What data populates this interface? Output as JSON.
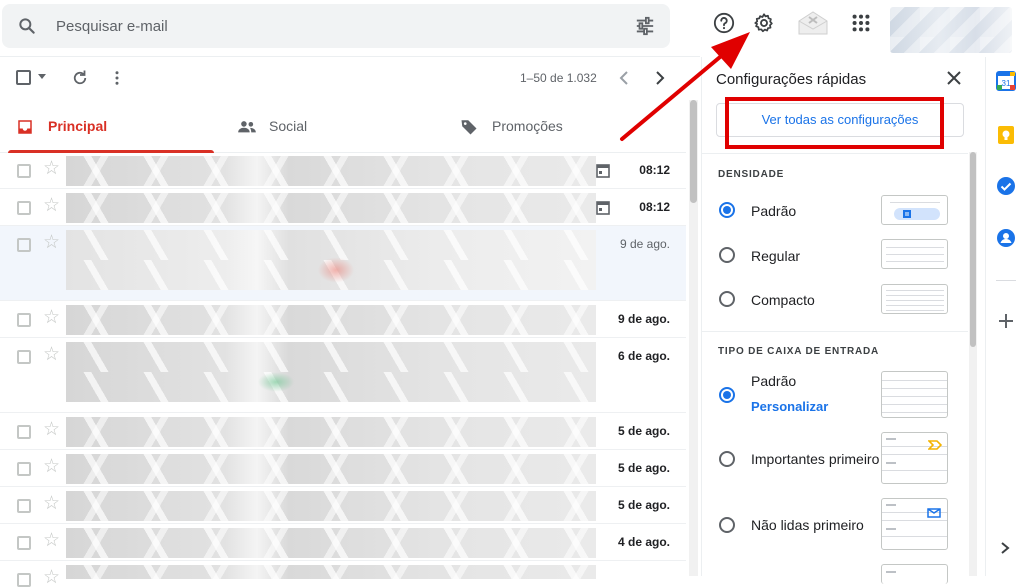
{
  "search": {
    "placeholder": "Pesquisar e-mail"
  },
  "toolbar": {
    "range": "1–50 de 1.032"
  },
  "tabs": [
    {
      "label": "Principal"
    },
    {
      "label": "Social"
    },
    {
      "label": "Promoções"
    }
  ],
  "emails": [
    {
      "date": "08:12"
    },
    {
      "date": "08:12"
    },
    {
      "date": "9 de ago."
    },
    {
      "date": "9 de ago."
    },
    {
      "date": "6 de ago."
    },
    {
      "date": "5 de ago."
    },
    {
      "date": "5 de ago."
    },
    {
      "date": "5 de ago."
    },
    {
      "date": "4 de ago."
    }
  ],
  "quick_settings": {
    "title": "Configurações rápidas",
    "view_all": "Ver todas as configurações",
    "density": {
      "heading": "DENSIDADE",
      "options": [
        {
          "label": "Padrão",
          "selected": true
        },
        {
          "label": "Regular",
          "selected": false
        },
        {
          "label": "Compacto",
          "selected": false
        }
      ]
    },
    "inbox_type": {
      "heading": "TIPO DE CAIXA DE ENTRADA",
      "options": [
        {
          "label": "Padrão",
          "sublabel": "Personalizar",
          "selected": true
        },
        {
          "label": "Importantes primeiro",
          "selected": false
        },
        {
          "label": "Não lidas primeiro",
          "selected": false
        }
      ]
    }
  },
  "colors": {
    "accent": "#1a73e8",
    "principal_red": "#d93025",
    "annotation_red": "#e00000"
  }
}
